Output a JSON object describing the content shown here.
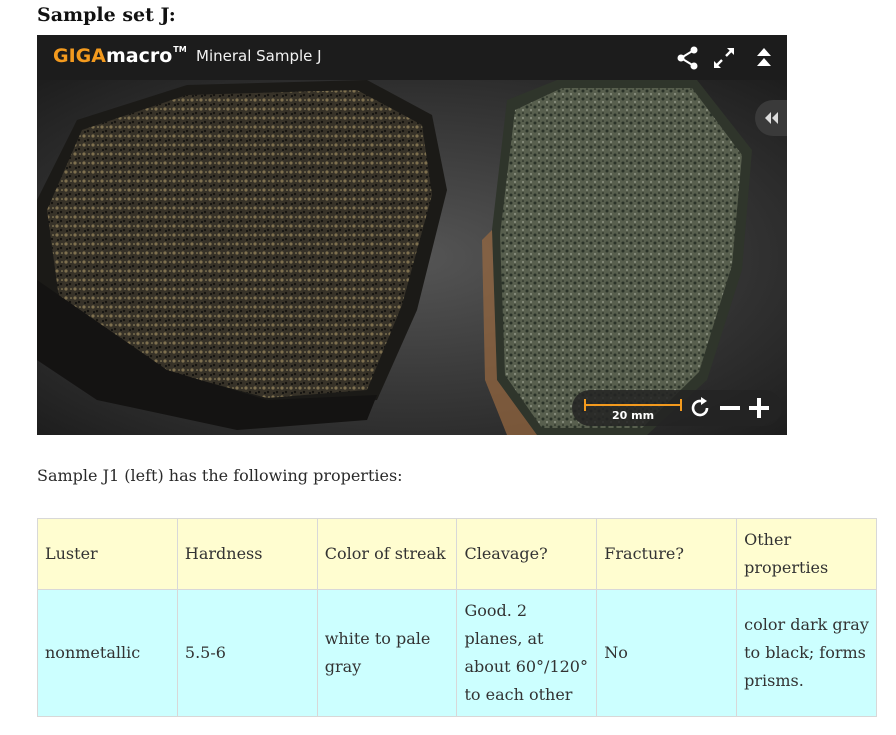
{
  "heading": "Sample set J:",
  "viewer": {
    "logo_giga": "GIGA",
    "logo_macro": "macro",
    "logo_tm": "TM",
    "title": "Mineral Sample J",
    "scale_label": "20 mm",
    "icons": [
      "share-icon",
      "fullscreen-icon",
      "collapse-icon",
      "rewind-icon",
      "rotate-icon",
      "zoom-out-icon",
      "zoom-in-icon"
    ],
    "accent_color": "#f39a1e"
  },
  "caption": "Sample J1 (left) has the following properties:",
  "table": {
    "headers": [
      "Luster",
      "Hardness",
      "Color of streak",
      "Cleavage?",
      "Fracture?",
      "Other properties"
    ],
    "row": [
      "nonmetallic",
      "5.5-6",
      "white to pale gray",
      "Good. 2 planes, at about 60°/120° to each other",
      "No",
      "color dark gray to black; forms prisms."
    ],
    "header_bg": "#fffdd0",
    "row_bg": "#ccffff"
  }
}
